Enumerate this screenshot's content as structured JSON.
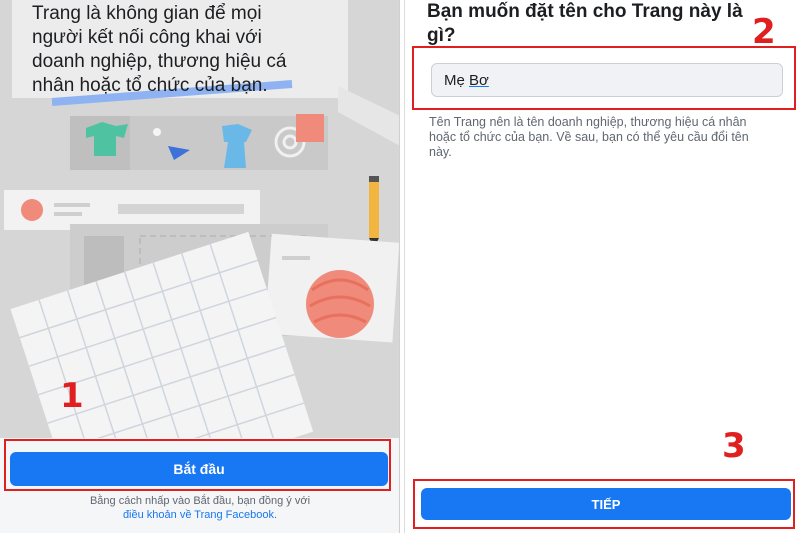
{
  "left_screen": {
    "intro_text": "Trang là không gian để mọi\nngười kết nối công khai với\ndoanh nghiệp, thương hiệu cá\nnhân hoặc tổ chức của bạn.",
    "start_button_label": "Bắt đầu",
    "terms_prefix": "Bằng cách nhấp vào Bắt đầu, bạn đồng ý với ",
    "terms_link": "điều khoản về Trang Facebook",
    "terms_suffix": "."
  },
  "right_screen": {
    "title": "Bạn muốn đặt tên cho Trang này là gì?",
    "page_name_value_a": "Mẹ ",
    "page_name_value_b": "Bơ",
    "helper_text": "Tên Trang nên là tên doanh nghiệp, thương hiệu cá nhân hoặc tổ chức của bạn. Về sau, bạn có thể yêu cầu đổi tên này.",
    "next_button_label": "TIẾP"
  },
  "annotations": {
    "step1": "1",
    "step2": "2",
    "step3": "3",
    "highlight_color": "#e02020"
  },
  "colors": {
    "facebook_blue": "#1877f2"
  }
}
